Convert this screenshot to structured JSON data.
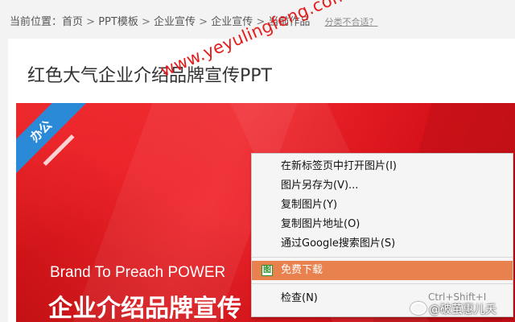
{
  "breadcrumb": {
    "prefix": "当前位置：",
    "items": [
      "首页",
      "PPT模板",
      "企业宣传",
      "企业宣传",
      "当前作品"
    ],
    "separator": " > ",
    "flag_link": "分类不合适？"
  },
  "page_title": "红色大气企业介绍品牌宣传PPT",
  "preview": {
    "ribbon_label": "办公",
    "brand_en": "Brand To Preach POWER",
    "brand_cn": "企业介绍品牌宣传",
    "watermark": "www.yeyulingfeng.com"
  },
  "context_menu": {
    "items": [
      {
        "label": "在新标签页中打开图片(I)"
      },
      {
        "label": "图片另存为(V)..."
      },
      {
        "label": "复制图片(Y)"
      },
      {
        "label": "复制图片地址(O)"
      },
      {
        "label": "通过Google搜索图片(S)"
      },
      {
        "label": "免费下载",
        "icon": "download-extension-icon",
        "icon_glyph": "图",
        "highlighted": true
      },
      {
        "label": "检查(N)"
      }
    ]
  },
  "shortcut_hint": "Ctrl+Shift+I",
  "weibo_watermark": "@破茧惠儿夭",
  "colors": {
    "banner_red": "#e2161c",
    "ribbon_blue": "#2b8ad8",
    "menu_highlight": "#e9814e",
    "watermark_red": "#e61c1c"
  }
}
